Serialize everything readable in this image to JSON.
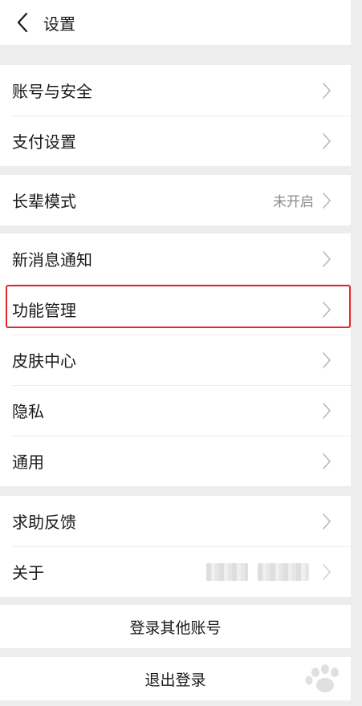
{
  "header": {
    "title": "设置"
  },
  "groups": [
    {
      "items": [
        {
          "label": "账号与安全"
        },
        {
          "label": "支付设置"
        }
      ]
    },
    {
      "items": [
        {
          "label": "长辈模式",
          "value": "未开启"
        }
      ]
    },
    {
      "items": [
        {
          "label": "新消息通知"
        },
        {
          "label": "功能管理"
        },
        {
          "label": "皮肤中心"
        },
        {
          "label": "隐私"
        },
        {
          "label": "通用"
        }
      ]
    },
    {
      "items": [
        {
          "label": "求助反馈"
        },
        {
          "label": "关于"
        }
      ]
    }
  ],
  "actions": {
    "switch_account": "登录其他账号",
    "logout": "退出登录"
  },
  "colors": {
    "highlight_border": "#e0282e",
    "page_background": "#ededed"
  },
  "icons": {
    "back": "chevron-left-icon",
    "row_arrow": "chevron-right-icon"
  }
}
